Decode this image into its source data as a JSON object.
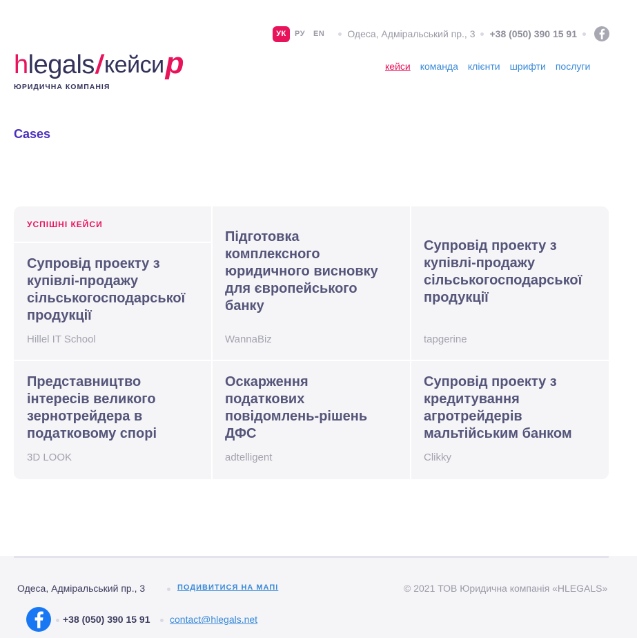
{
  "header": {
    "languages": [
      "УК",
      "РУ",
      "EN"
    ],
    "active_language": "УК",
    "address": "Одеса, Адміральський пр., 3",
    "phone": "+38 (050) 390 15 91",
    "social_icon": "facebook-icon"
  },
  "logo": {
    "h": "h",
    "legals": "legals",
    "slash": "/",
    "keisy": "кейси",
    "p": "p",
    "subtitle": "ЮРИДИЧНА КОМПАНІЯ"
  },
  "nav": {
    "items": [
      "кейси",
      "команда",
      "клієнти",
      "шрифти",
      "послуги"
    ],
    "active": "кейси"
  },
  "page": {
    "title": "Cases",
    "section_label": "УСПІШНІ КЕЙСИ"
  },
  "cases": [
    {
      "title": "Супровід проекту з купівлі-продажу сільськогосподарської продукції",
      "client": "Hillel IT School"
    },
    {
      "title": "Підготовка комплексного юридичного висновку для європейського банку",
      "client": "WannaBiz"
    },
    {
      "title": "Супровід проекту з купівлі-продажу сільськогосподарської продукції",
      "client": "tapgerine"
    },
    {
      "title": "Представництво інтересів великого зернотрейдера в податковому спорі",
      "client": "3D LOOK"
    },
    {
      "title": "Оскарження податкових повідомлень-рішень ДФС",
      "client": "adtelligent"
    },
    {
      "title": "Супровід проекту з кредитування агротрейдерів мальтійським банком",
      "client": "Clikky"
    }
  ],
  "footer": {
    "address": "Одеса, Адміральський пр., 3",
    "map_link": "ПОДИВИТИСЯ НА МАПІ",
    "copyright": "© 2021 ТОВ Юридична компанія «HLEGALS»",
    "phone": "+38 (050) 390 15 91",
    "email": "contact@hlegals.net"
  },
  "colors": {
    "accent": "#e8135a",
    "link": "#3a8ad8",
    "title": "#4b2fbf",
    "card_bg": "#f5f5f8"
  }
}
